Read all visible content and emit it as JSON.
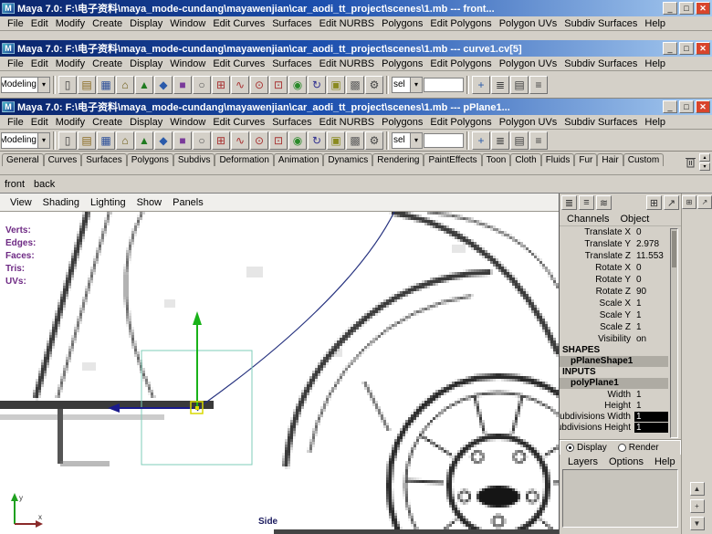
{
  "chrome": {
    "logo": "M",
    "minimize": "_",
    "maximize": "□",
    "close": "✕"
  },
  "windows": [
    {
      "title": "Maya 7.0: F:\\电子资料\\maya_mode-cundang\\mayawenjian\\car_aodi_tt_project\\scenes\\1.mb  ---  front..."
    },
    {
      "title": "Maya 7.0: F:\\电子资料\\maya_mode-cundang\\mayawenjian\\car_aodi_tt_project\\scenes\\1.mb  ---  curve1.cv[5]"
    },
    {
      "title": "Maya 7.0: F:\\电子资料\\maya_mode-cundang\\mayawenjian\\car_aodi_tt_project\\scenes\\1.mb  ---  pPlane1..."
    }
  ],
  "menu_items": [
    "File",
    "Edit",
    "Modify",
    "Create",
    "Display",
    "Window",
    "Edit Curves",
    "Surfaces",
    "Edit NURBS",
    "Polygons",
    "Edit Polygons",
    "Polygon UVs",
    "Subdiv Surfaces",
    "Help"
  ],
  "toolbar": {
    "menu_set": "Modeling",
    "sel_label": "sel",
    "icons": [
      {
        "name": "new-scene-icon",
        "glyph": "▯",
        "color": "#404040"
      },
      {
        "name": "open-scene-icon",
        "glyph": "▤",
        "color": "#8a6a20"
      },
      {
        "name": "save-scene-icon",
        "glyph": "▦",
        "color": "#2a4e9a"
      },
      {
        "name": "select-hierarchy-icon",
        "glyph": "⌂",
        "color": "#6a5a10"
      },
      {
        "name": "select-object-icon",
        "glyph": "▲",
        "color": "#1f7a1f"
      },
      {
        "name": "select-component-icon",
        "glyph": "◆",
        "color": "#2a5aaa"
      },
      {
        "name": "select-faces-icon",
        "glyph": "■",
        "color": "#7a3a9a"
      },
      {
        "name": "lasso-select-icon",
        "glyph": "○",
        "color": "#555555"
      },
      {
        "name": "snap-grid-icon",
        "glyph": "⊞",
        "color": "#a83030"
      },
      {
        "name": "snap-curve-icon",
        "glyph": "∿",
        "color": "#a83030"
      },
      {
        "name": "snap-point-icon",
        "glyph": "⊙",
        "color": "#a83030"
      },
      {
        "name": "snap-view-plane-icon",
        "glyph": "⊡",
        "color": "#a83030"
      },
      {
        "name": "make-live-icon",
        "glyph": "◉",
        "color": "#2a8a2a"
      },
      {
        "name": "construction-history-icon",
        "glyph": "↻",
        "color": "#303090"
      },
      {
        "name": "render-current-frame-icon",
        "glyph": "▣",
        "color": "#8a8a20"
      },
      {
        "name": "ipr-render-icon",
        "glyph": "▩",
        "color": "#606060"
      },
      {
        "name": "render-globals-icon",
        "glyph": "⚙",
        "color": "#444444"
      }
    ],
    "right_icons": [
      {
        "name": "show-manipulator-icon",
        "glyph": "+",
        "color": "#2a5aaa"
      },
      {
        "name": "channel-box-toggle-icon",
        "glyph": "≣",
        "color": "#404040"
      },
      {
        "name": "layer-editor-toggle-icon",
        "glyph": "▤",
        "color": "#404040"
      },
      {
        "name": "attribute-editor-toggle-icon",
        "glyph": "≡",
        "color": "#404040"
      }
    ]
  },
  "shelf": {
    "tabs": [
      "General",
      "Curves",
      "Surfaces",
      "Polygons",
      "Subdivs",
      "Deformation",
      "Animation",
      "Dynamics",
      "Rendering",
      "PaintEffects",
      "Toon",
      "Cloth",
      "Fluids",
      "Fur",
      "Hair",
      "Custom"
    ]
  },
  "layout_tabs": [
    "front",
    "back"
  ],
  "panel_menu": [
    "View",
    "Shading",
    "Lighting",
    "Show",
    "Panels"
  ],
  "viewport": {
    "hud": [
      "Verts:",
      "Edges:",
      "Faces:",
      "Tris:",
      "UVs:"
    ],
    "label": "Side",
    "axis": {
      "x": "x",
      "y": "y"
    }
  },
  "channel_box": {
    "top_icons": [
      {
        "name": "channel-manipulator-icon",
        "glyph": "≣",
        "color": "#333333"
      },
      {
        "name": "channel-speed-icon",
        "glyph": "≡",
        "color": "#333333"
      },
      {
        "name": "channel-hyperbolic-icon",
        "glyph": "≋",
        "color": "#333333"
      }
    ],
    "corner_icons": [
      {
        "name": "panel-layout-icon",
        "glyph": "⊞",
        "color": "#333333"
      },
      {
        "name": "pointer-icon",
        "glyph": "↗",
        "color": "#333333"
      }
    ],
    "menu": [
      "Channels",
      "Object"
    ],
    "rows": [
      {
        "label": "Translate X",
        "value": "0"
      },
      {
        "label": "Translate Y",
        "value": "2.978"
      },
      {
        "label": "Translate Z",
        "value": "11.553"
      },
      {
        "label": "Rotate X",
        "value": "0"
      },
      {
        "label": "Rotate Y",
        "value": "0"
      },
      {
        "label": "Rotate Z",
        "value": "90"
      },
      {
        "label": "Scale X",
        "value": "1"
      },
      {
        "label": "Scale Y",
        "value": "1"
      },
      {
        "label": "Scale Z",
        "value": "1"
      },
      {
        "label": "Visibility",
        "value": "on"
      }
    ],
    "shapes_header": "SHAPES",
    "shape_name": "pPlaneShape1",
    "inputs_header": "INPUTS",
    "input_name": "polyPlane1",
    "input_rows": [
      {
        "label": "Width",
        "value": "1",
        "dark": false
      },
      {
        "label": "Height",
        "value": "1",
        "dark": false
      },
      {
        "label": "Subdivisions Width",
        "value": "1",
        "dark": true
      },
      {
        "label": "Subdivisions Height",
        "value": "1",
        "dark": true
      }
    ]
  },
  "layer_editor": {
    "display_label": "Display",
    "render_label": "Render",
    "menu": [
      "Layers",
      "Options",
      "Help"
    ]
  },
  "right_strip": {
    "bottom_icons": [
      {
        "name": "scroll-up-icon",
        "glyph": "▲",
        "color": "#333333"
      },
      {
        "name": "pan-icon",
        "glyph": "+",
        "color": "#333333"
      },
      {
        "name": "scroll-down-icon",
        "glyph": "▼",
        "color": "#333333"
      }
    ]
  },
  "colors": {
    "titlebar_left": "#0a246a",
    "titlebar_right": "#a6caf0",
    "manip_green": "#19b219",
    "manip_blue": "#1a1a8c",
    "manip_yellow": "#d9d900",
    "plane_teal": "#7fccb8",
    "curve_blue": "#26327f",
    "axis_green": "#1fa01f",
    "axis_red": "#8a2a2a"
  }
}
